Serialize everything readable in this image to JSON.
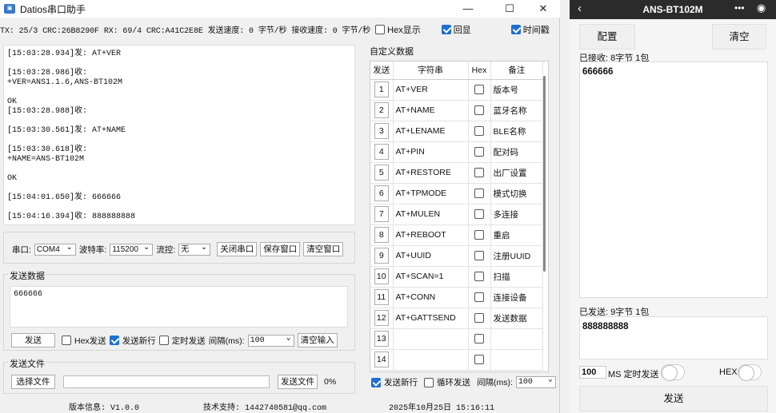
{
  "window": {
    "title": "Datios串口助手",
    "app_icon": "datios-app-icon",
    "controls": [
      "minimize-icon",
      "maximize-icon",
      "close-icon"
    ]
  },
  "stats": {
    "text": "TX: 25/3 CRC:26B8290F RX: 69/4 CRC:A41C2E8E 发送速度: 0 字节/秒 接收速度: 0 字节/秒",
    "hex_display": {
      "label": "Hex显示",
      "checked": false
    },
    "echo": {
      "label": "回显",
      "checked": true
    },
    "timestamp": {
      "label": "时间戳",
      "checked": true
    }
  },
  "log": {
    "lines": [
      "[15:03:28.934]发: AT+VER",
      "",
      "[15:03:28.986]收:",
      "+VER=ANS1.1.6,ANS-BT102M",
      "",
      "OK",
      "[15:03:28.988]收:",
      "",
      "[15:03:30.561]发: AT+NAME",
      "",
      "[15:03:30.618]收:",
      "+NAME=ANS-BT102M",
      "",
      "OK",
      "",
      "[15:04:01.650]发: 666666",
      "",
      "[15:04:16.394]收: 888888888"
    ]
  },
  "port": {
    "port_label": "串口:",
    "port_value": "COM4",
    "baud_label": "波特率:",
    "baud_value": "115200",
    "flow_label": "流控:",
    "flow_value": "无",
    "close_button": "关闭串口",
    "save_button": "保存窗口",
    "clear_button": "清空窗口"
  },
  "send": {
    "group_label": "发送数据",
    "content": "666666",
    "send_button": "发送",
    "hex_send": {
      "label": "Hex发送",
      "checked": false
    },
    "newline": {
      "label": "发送新行",
      "checked": true
    },
    "timed": {
      "label": "定时发送",
      "checked": false
    },
    "interval_label": "间隔(ms):",
    "interval_value": "100",
    "clear_button": "清空输入"
  },
  "file": {
    "group_label": "发送文件",
    "choose_button": "选择文件",
    "path": "",
    "send_button": "发送文件",
    "progress": "0%"
  },
  "status": {
    "version": "版本信息: V1.0.0",
    "support": "技术支持: 1442740581@qq.com",
    "datetime": "2025年10月25日  15:16:11"
  },
  "custom": {
    "title": "自定义数据",
    "headers": {
      "send": "发送",
      "command": "字符串",
      "hex": "Hex",
      "note": "备注"
    },
    "rows": [
      {
        "n": "1",
        "cmd": "AT+VER",
        "note": "版本号"
      },
      {
        "n": "2",
        "cmd": "AT+NAME",
        "note": "蓝牙名称"
      },
      {
        "n": "3",
        "cmd": "AT+LENAME",
        "note": "BLE名称"
      },
      {
        "n": "4",
        "cmd": "AT+PIN",
        "note": "配对码"
      },
      {
        "n": "5",
        "cmd": "AT+RESTORE",
        "note": "出厂设置"
      },
      {
        "n": "6",
        "cmd": "AT+TPMODE",
        "note": "模式切换"
      },
      {
        "n": "7",
        "cmd": "AT+MULEN",
        "note": "多连接"
      },
      {
        "n": "8",
        "cmd": "AT+REBOOT",
        "note": "重启"
      },
      {
        "n": "9",
        "cmd": "AT+UUID",
        "note": "注册UUID"
      },
      {
        "n": "10",
        "cmd": "AT+SCAN=1",
        "note": "扫描"
      },
      {
        "n": "11",
        "cmd": "AT+CONN",
        "note": "连接设备"
      },
      {
        "n": "12",
        "cmd": "AT+GATTSEND",
        "note": "发送数据"
      },
      {
        "n": "13",
        "cmd": "",
        "note": ""
      },
      {
        "n": "14",
        "cmd": "",
        "note": ""
      }
    ],
    "newline": {
      "label": "发送新行",
      "checked": true
    },
    "loop": {
      "label": "循环发送",
      "checked": false
    },
    "interval_label": "间隔(ms):",
    "interval_value": "100"
  },
  "phone": {
    "title": "ANS-BT102M",
    "config_button": "配置",
    "clear_button": "清空",
    "received_label": "已接收: 8字节 1包",
    "received_content": "666666",
    "sent_label": "已发送: 9字节 1包",
    "sent_content": "888888888",
    "interval_value": "100",
    "ms_label": "MS 定时发送",
    "hex_label": "HEX",
    "send_button": "发送"
  },
  "colors": {
    "accent": "#1f6fd0",
    "phone_header": "#2b2b2b"
  }
}
